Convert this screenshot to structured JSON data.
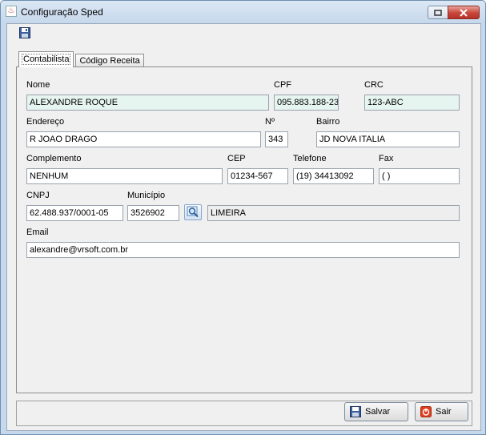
{
  "window": {
    "title": "Configuração Sped"
  },
  "tabs": [
    {
      "label": "Contabilista",
      "active": true
    },
    {
      "label": "Código Receita",
      "active": false
    }
  ],
  "form": {
    "nome": {
      "label": "Nome",
      "value": "ALEXANDRE ROQUE"
    },
    "cpf": {
      "label": "CPF",
      "value": "095.883.188-23"
    },
    "crc": {
      "label": "CRC",
      "value": "123-ABC"
    },
    "endereco": {
      "label": "Endereço",
      "value": "R JOAO DRAGO"
    },
    "numero": {
      "label": "Nº",
      "value": "343"
    },
    "bairro": {
      "label": "Bairro",
      "value": "JD NOVA ITALIA"
    },
    "complemento": {
      "label": "Complemento",
      "value": "NENHUM"
    },
    "cep": {
      "label": "CEP",
      "value": "01234-567"
    },
    "telefone": {
      "label": "Telefone",
      "value": "(19) 34413092"
    },
    "fax": {
      "label": "Fax",
      "value": "( )"
    },
    "cnpj": {
      "label": "CNPJ",
      "value": "62.488.937/0001-05"
    },
    "municipio": {
      "label": "Município",
      "code": "3526902",
      "name": "LIMEIRA"
    },
    "email": {
      "label": "Email",
      "value": "alexandre@vrsoft.com.br"
    }
  },
  "buttons": {
    "salvar": "Salvar",
    "sair": "Sair"
  },
  "icons": {
    "toolbar": "save-icon",
    "search": "magnifier-icon",
    "exit": "power-icon"
  }
}
